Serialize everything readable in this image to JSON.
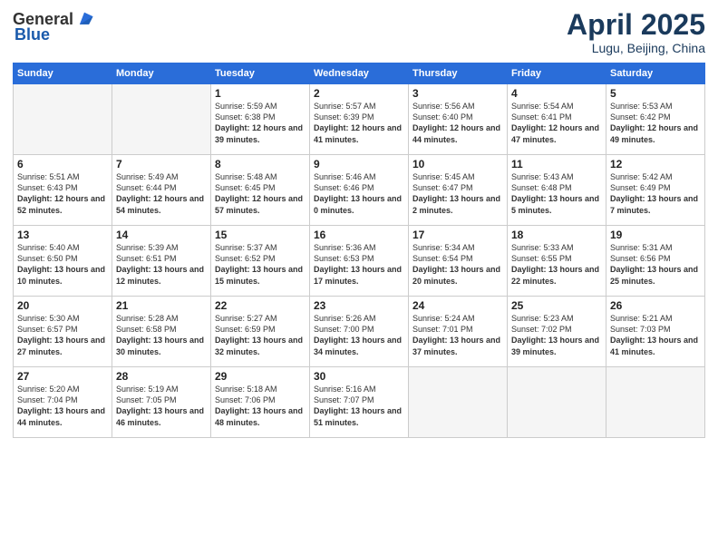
{
  "header": {
    "logo_general": "General",
    "logo_blue": "Blue",
    "month_title": "April 2025",
    "location": "Lugu, Beijing, China"
  },
  "weekdays": [
    "Sunday",
    "Monday",
    "Tuesday",
    "Wednesday",
    "Thursday",
    "Friday",
    "Saturday"
  ],
  "weeks": [
    [
      {
        "day": "",
        "info": ""
      },
      {
        "day": "",
        "info": ""
      },
      {
        "day": "1",
        "info": "Sunrise: 5:59 AM\nSunset: 6:38 PM\nDaylight: 12 hours and 39 minutes."
      },
      {
        "day": "2",
        "info": "Sunrise: 5:57 AM\nSunset: 6:39 PM\nDaylight: 12 hours and 41 minutes."
      },
      {
        "day": "3",
        "info": "Sunrise: 5:56 AM\nSunset: 6:40 PM\nDaylight: 12 hours and 44 minutes."
      },
      {
        "day": "4",
        "info": "Sunrise: 5:54 AM\nSunset: 6:41 PM\nDaylight: 12 hours and 47 minutes."
      },
      {
        "day": "5",
        "info": "Sunrise: 5:53 AM\nSunset: 6:42 PM\nDaylight: 12 hours and 49 minutes."
      }
    ],
    [
      {
        "day": "6",
        "info": "Sunrise: 5:51 AM\nSunset: 6:43 PM\nDaylight: 12 hours and 52 minutes."
      },
      {
        "day": "7",
        "info": "Sunrise: 5:49 AM\nSunset: 6:44 PM\nDaylight: 12 hours and 54 minutes."
      },
      {
        "day": "8",
        "info": "Sunrise: 5:48 AM\nSunset: 6:45 PM\nDaylight: 12 hours and 57 minutes."
      },
      {
        "day": "9",
        "info": "Sunrise: 5:46 AM\nSunset: 6:46 PM\nDaylight: 13 hours and 0 minutes."
      },
      {
        "day": "10",
        "info": "Sunrise: 5:45 AM\nSunset: 6:47 PM\nDaylight: 13 hours and 2 minutes."
      },
      {
        "day": "11",
        "info": "Sunrise: 5:43 AM\nSunset: 6:48 PM\nDaylight: 13 hours and 5 minutes."
      },
      {
        "day": "12",
        "info": "Sunrise: 5:42 AM\nSunset: 6:49 PM\nDaylight: 13 hours and 7 minutes."
      }
    ],
    [
      {
        "day": "13",
        "info": "Sunrise: 5:40 AM\nSunset: 6:50 PM\nDaylight: 13 hours and 10 minutes."
      },
      {
        "day": "14",
        "info": "Sunrise: 5:39 AM\nSunset: 6:51 PM\nDaylight: 13 hours and 12 minutes."
      },
      {
        "day": "15",
        "info": "Sunrise: 5:37 AM\nSunset: 6:52 PM\nDaylight: 13 hours and 15 minutes."
      },
      {
        "day": "16",
        "info": "Sunrise: 5:36 AM\nSunset: 6:53 PM\nDaylight: 13 hours and 17 minutes."
      },
      {
        "day": "17",
        "info": "Sunrise: 5:34 AM\nSunset: 6:54 PM\nDaylight: 13 hours and 20 minutes."
      },
      {
        "day": "18",
        "info": "Sunrise: 5:33 AM\nSunset: 6:55 PM\nDaylight: 13 hours and 22 minutes."
      },
      {
        "day": "19",
        "info": "Sunrise: 5:31 AM\nSunset: 6:56 PM\nDaylight: 13 hours and 25 minutes."
      }
    ],
    [
      {
        "day": "20",
        "info": "Sunrise: 5:30 AM\nSunset: 6:57 PM\nDaylight: 13 hours and 27 minutes."
      },
      {
        "day": "21",
        "info": "Sunrise: 5:28 AM\nSunset: 6:58 PM\nDaylight: 13 hours and 30 minutes."
      },
      {
        "day": "22",
        "info": "Sunrise: 5:27 AM\nSunset: 6:59 PM\nDaylight: 13 hours and 32 minutes."
      },
      {
        "day": "23",
        "info": "Sunrise: 5:26 AM\nSunset: 7:00 PM\nDaylight: 13 hours and 34 minutes."
      },
      {
        "day": "24",
        "info": "Sunrise: 5:24 AM\nSunset: 7:01 PM\nDaylight: 13 hours and 37 minutes."
      },
      {
        "day": "25",
        "info": "Sunrise: 5:23 AM\nSunset: 7:02 PM\nDaylight: 13 hours and 39 minutes."
      },
      {
        "day": "26",
        "info": "Sunrise: 5:21 AM\nSunset: 7:03 PM\nDaylight: 13 hours and 41 minutes."
      }
    ],
    [
      {
        "day": "27",
        "info": "Sunrise: 5:20 AM\nSunset: 7:04 PM\nDaylight: 13 hours and 44 minutes."
      },
      {
        "day": "28",
        "info": "Sunrise: 5:19 AM\nSunset: 7:05 PM\nDaylight: 13 hours and 46 minutes."
      },
      {
        "day": "29",
        "info": "Sunrise: 5:18 AM\nSunset: 7:06 PM\nDaylight: 13 hours and 48 minutes."
      },
      {
        "day": "30",
        "info": "Sunrise: 5:16 AM\nSunset: 7:07 PM\nDaylight: 13 hours and 51 minutes."
      },
      {
        "day": "",
        "info": ""
      },
      {
        "day": "",
        "info": ""
      },
      {
        "day": "",
        "info": ""
      }
    ]
  ]
}
